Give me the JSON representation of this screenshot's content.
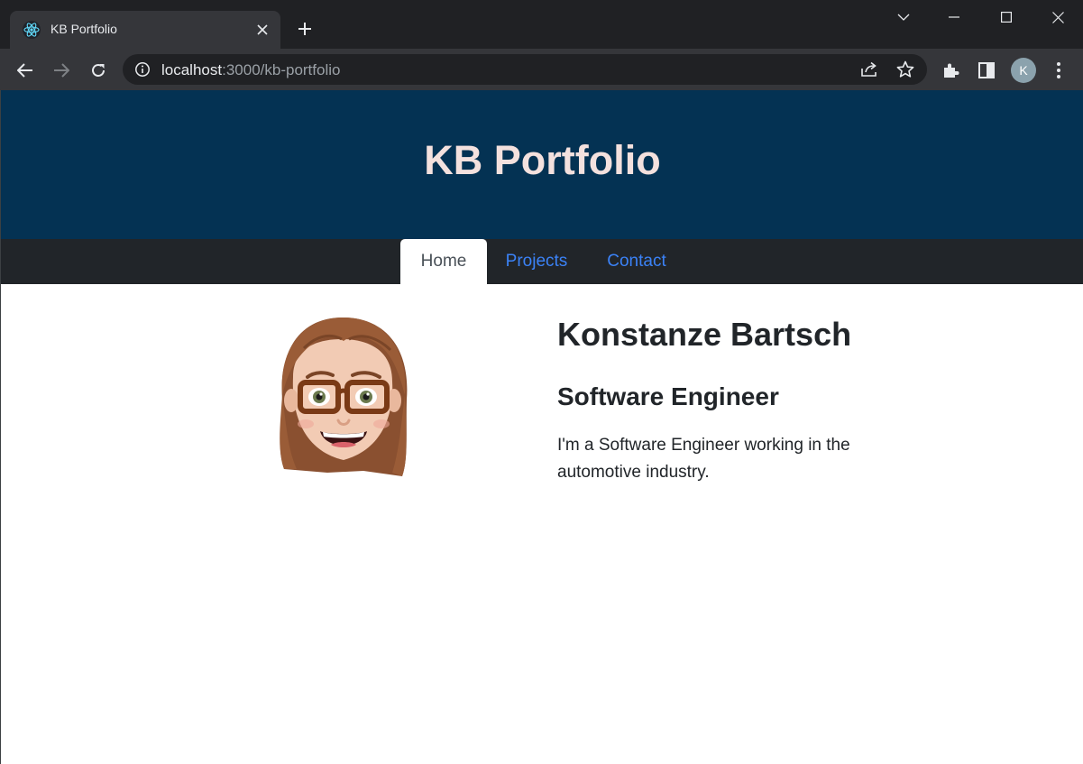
{
  "browser": {
    "tab_title": "KB Portfolio",
    "url_host": "localhost",
    "url_path": ":3000/kb-portfolio",
    "profile_initial": "K",
    "icons": [
      "react-favicon-icon",
      "close-icon",
      "plus-icon",
      "chevron-down-icon",
      "minimize-icon",
      "maximize-icon",
      "close-window-icon",
      "back-arrow-icon",
      "forward-arrow-icon",
      "reload-icon",
      "info-icon",
      "share-icon",
      "star-icon",
      "extensions-icon",
      "side-panel-icon",
      "more-icon"
    ]
  },
  "site": {
    "title": "KB Portfolio",
    "nav": [
      {
        "label": "Home",
        "active": true
      },
      {
        "label": "Projects",
        "active": false
      },
      {
        "label": "Contact",
        "active": false
      }
    ]
  },
  "profile": {
    "name": "Konstanze Bartsch",
    "role": "Software Engineer",
    "bio": "I'm a Software Engineer working in the automotive industry."
  },
  "colors": {
    "hero_bg": "#043253",
    "title_color": "#f4e1de",
    "nav_bg": "#212529",
    "link_color": "#3b82f6"
  }
}
